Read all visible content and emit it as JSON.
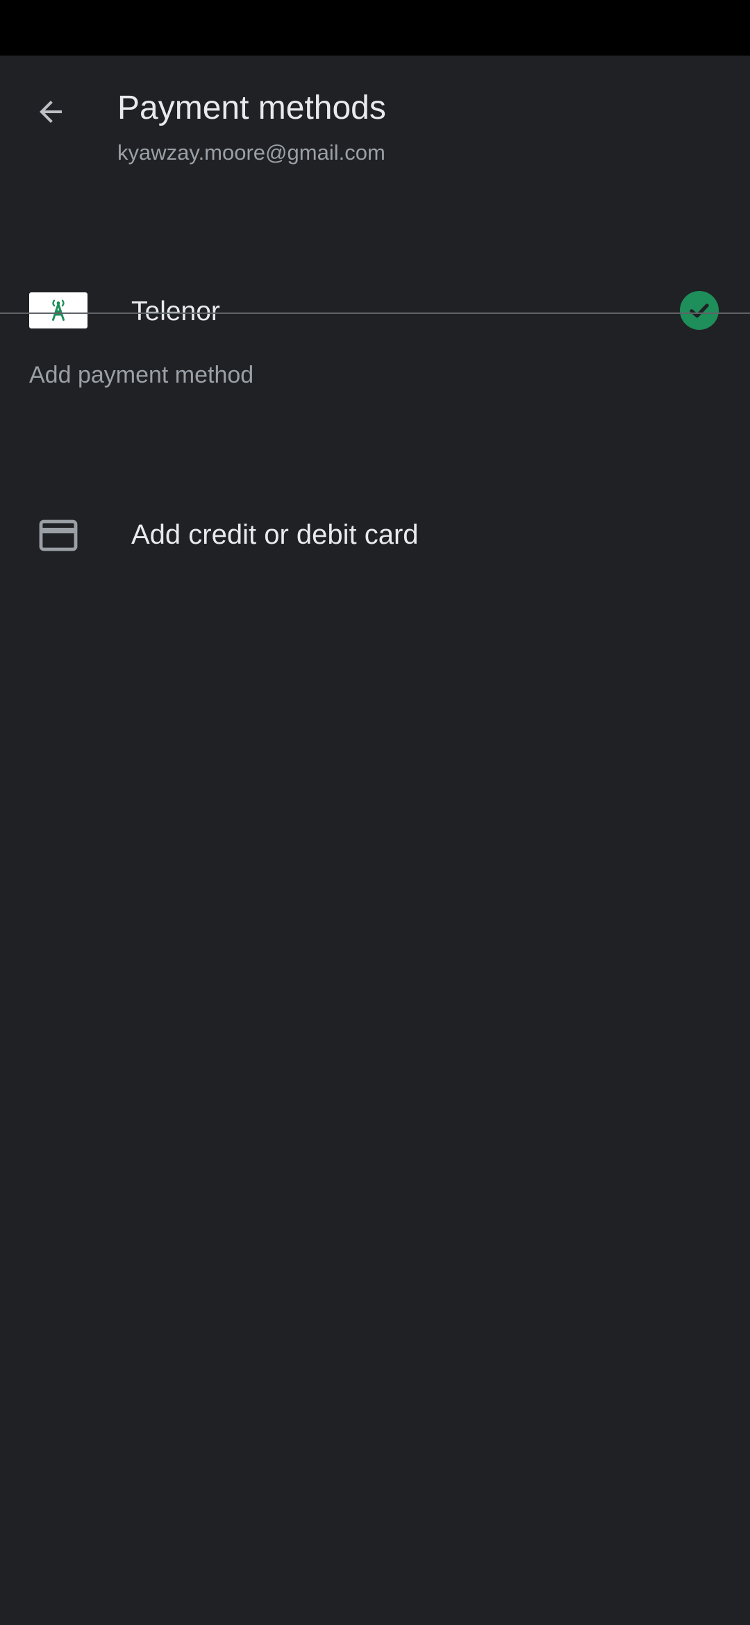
{
  "header": {
    "title": "Payment methods",
    "email": "kyawzay.moore@gmail.com",
    "back_icon": "arrow-back-icon"
  },
  "payment_methods": [
    {
      "label": "Telenor",
      "logo_icon": "telenor-tower-icon",
      "selected": true,
      "selected_icon": "check-circle-icon"
    }
  ],
  "add_section": {
    "header": "Add payment method",
    "items": [
      {
        "label": "Add credit or debit card",
        "icon": "credit-card-icon"
      }
    ]
  },
  "colors": {
    "background": "#202124",
    "status_bar": "#000000",
    "primary_text": "#e8eaed",
    "secondary_text": "#9aa0a6",
    "accent_green": "#1e8e5a",
    "divider": "#5f6368"
  }
}
